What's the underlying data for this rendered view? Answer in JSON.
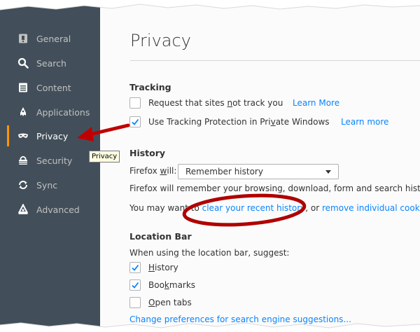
{
  "sidebar": {
    "items": [
      {
        "label": "General",
        "icon": "general-icon"
      },
      {
        "label": "Search",
        "icon": "search-icon"
      },
      {
        "label": "Content",
        "icon": "content-icon"
      },
      {
        "label": "Applications",
        "icon": "applications-icon"
      },
      {
        "label": "Privacy",
        "icon": "privacy-mask-icon",
        "selected": true
      },
      {
        "label": "Security",
        "icon": "security-icon"
      },
      {
        "label": "Sync",
        "icon": "sync-icon"
      },
      {
        "label": "Advanced",
        "icon": "advanced-icon"
      }
    ],
    "tooltip": "Privacy"
  },
  "main": {
    "title": "Privacy",
    "tracking": {
      "heading": "Tracking",
      "dnt_label_a": "Request that sites ",
      "dnt_label_u": "n",
      "dnt_label_b": "ot track you",
      "dnt_checked": false,
      "dnt_learn_more": "Learn More",
      "tp_label_a": "Use Tracking Protection in Pri",
      "tp_label_u": "v",
      "tp_label_b": "ate Windows",
      "tp_checked": true,
      "tp_learn_more": "Learn more"
    },
    "history": {
      "heading": "History",
      "will_label_a": "Firefox ",
      "will_label_u": "w",
      "will_label_b": "ill:",
      "select_value": "Remember history",
      "remember_text": "Firefox will remember your browsing, download, form and search history.",
      "may_want_a": "You may want to ",
      "clear_link": "clear your recent history",
      "may_want_b": ", or ",
      "remove_link": "remove individual cookies."
    },
    "location_bar": {
      "heading": "Location Bar",
      "suggest_label": "When using the location bar, suggest:",
      "options": [
        {
          "label_u": "H",
          "label_rest": "istory",
          "checked": true
        },
        {
          "label_u": "",
          "label_pre": "Boo",
          "label_mid": "k",
          "label_rest": "marks",
          "checked": true
        },
        {
          "label_u": "O",
          "label_rest": "pen tabs",
          "checked": false
        }
      ],
      "prefs_link": "Change preferences for search engine suggestions..."
    }
  },
  "colors": {
    "sidebar_bg": "#424f5a",
    "selected_accent": "#ff9500",
    "link": "#0a84ff",
    "annotation_red": "#c00000"
  }
}
